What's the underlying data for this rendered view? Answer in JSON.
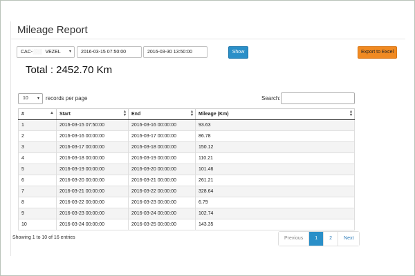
{
  "page": {
    "title": "Mileage Report",
    "total": "Total : 2452.70 Km"
  },
  "filters": {
    "vehicle_prefix": "CAC-",
    "vehicle_masked": "░░░",
    "vehicle_name": "VEZEL",
    "start": "2016-03-15 07:50:00",
    "end": "2016-03-30 13:50:00",
    "show_label": "Show",
    "export_label": "Export to Excel"
  },
  "table_controls": {
    "page_length": "10",
    "length_label": "records per page",
    "search_label": "Search:",
    "search_value": ""
  },
  "table": {
    "columns": [
      "#",
      "Start",
      "End",
      "Mileage (Km)"
    ],
    "rows": [
      [
        "1",
        "2016-03-15 07:50:00",
        "2016-03-16 00:00:00",
        "93.63"
      ],
      [
        "2",
        "2016-03-16 00:00:00",
        "2016-03-17 00:00:00",
        "86.78"
      ],
      [
        "3",
        "2016-03-17 00:00:00",
        "2016-03-18 00:00:00",
        "150.12"
      ],
      [
        "4",
        "2016-03-18 00:00:00",
        "2016-03-19 00:00:00",
        "110.21"
      ],
      [
        "5",
        "2016-03-19 00:00:00",
        "2016-03-20 00:00:00",
        "101.46"
      ],
      [
        "6",
        "2016-03-20 00:00:00",
        "2016-03-21 00:00:00",
        "261.21"
      ],
      [
        "7",
        "2016-03-21 00:00:00",
        "2016-03-22 00:00:00",
        "328.64"
      ],
      [
        "8",
        "2016-03-22 00:00:00",
        "2016-03-23 00:00:00",
        "6.79"
      ],
      [
        "9",
        "2016-03-23 00:00:00",
        "2016-03-24 00:00:00",
        "102.74"
      ],
      [
        "10",
        "2016-03-24 00:00:00",
        "2016-03-25 00:00:00",
        "143.35"
      ]
    ]
  },
  "footer": {
    "info": "Showing 1 to 10 of 16 entries",
    "previous": "Previous",
    "page1": "1",
    "page2": "2",
    "next": "Next"
  },
  "icons": {
    "select_caret": "▾",
    "sort_up": "▲",
    "sort_both_up": "▴",
    "sort_both_down": "▾"
  },
  "colors": {
    "show_button": "#2a8fc8",
    "export_button": "#f08a22",
    "active_page": "#2a8fc8"
  }
}
